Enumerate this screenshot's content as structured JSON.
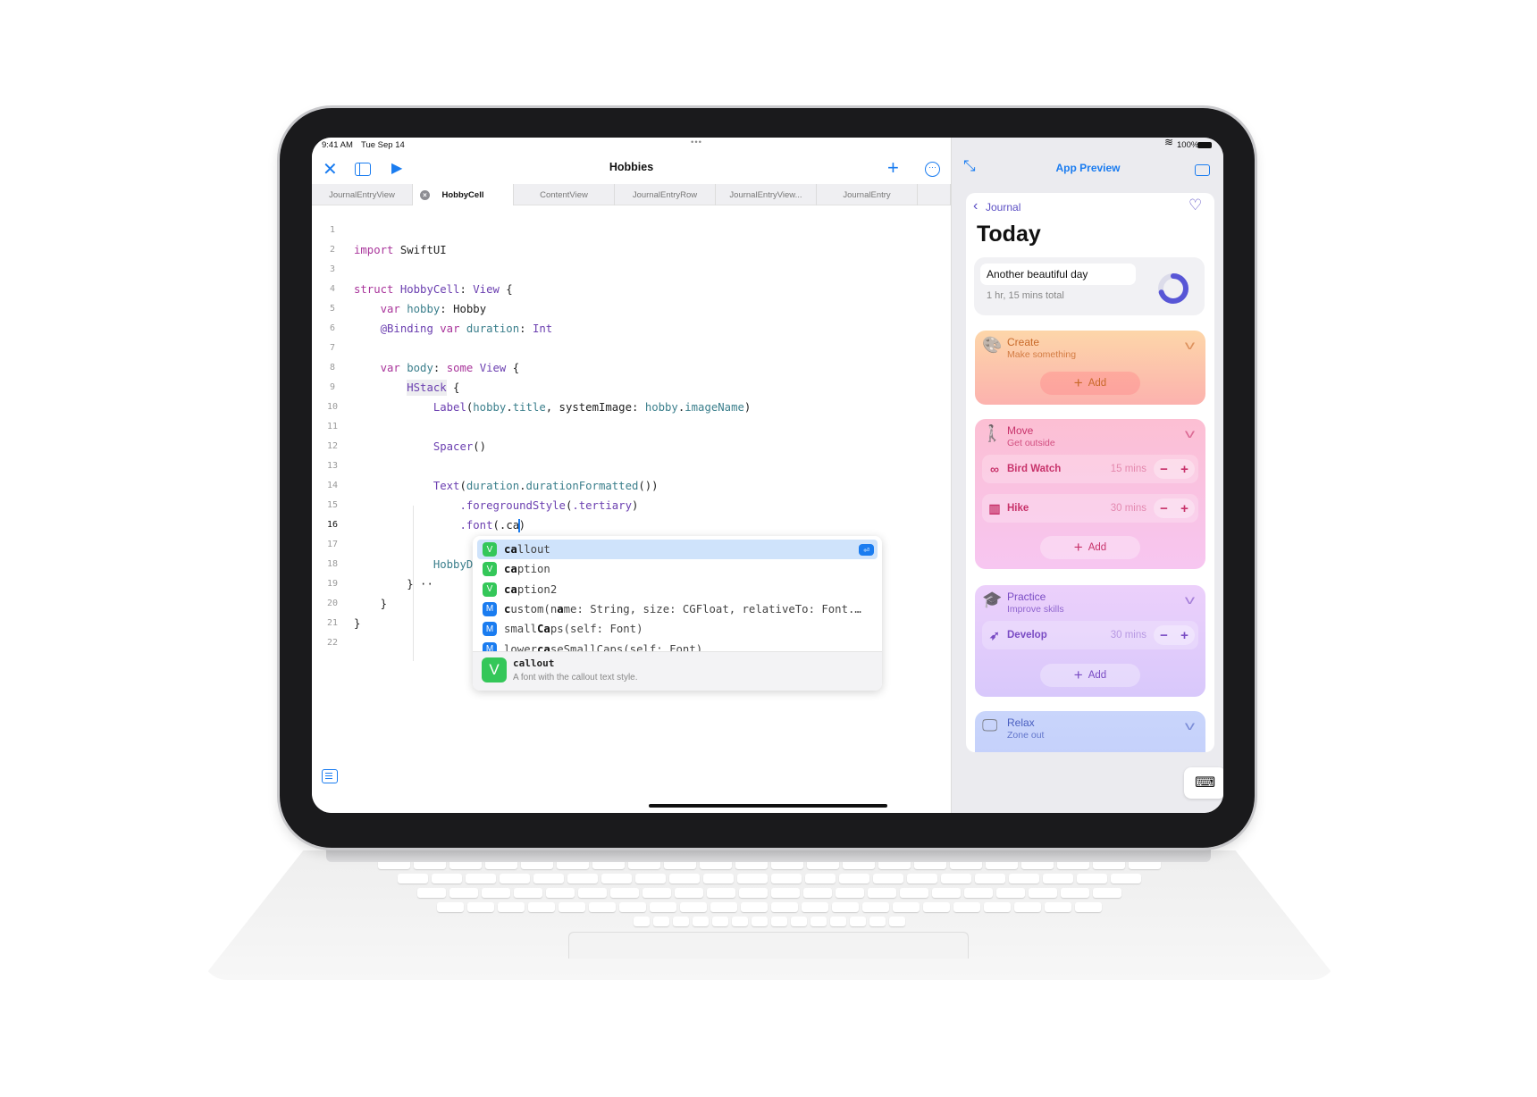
{
  "status": {
    "time": "9:41 AM",
    "date": "Tue Sep 14",
    "battery": "100%",
    "dots": "•••"
  },
  "editor": {
    "title": "Hobbies",
    "tabs": [
      {
        "label": "JournalEntryView"
      },
      {
        "label": "HobbyCell",
        "active": true
      },
      {
        "label": "ContentView"
      },
      {
        "label": "JournalEntryRow"
      },
      {
        "label": "JournalEntryView..."
      },
      {
        "label": "JournalEntry"
      },
      {
        "label": ""
      }
    ],
    "current_line": 16,
    "lines": [
      [],
      [
        [
          "import",
          "k"
        ],
        [
          " SwiftUI",
          "pl"
        ]
      ],
      [],
      [
        [
          "struct",
          "k"
        ],
        [
          " HobbyCell",
          "ty"
        ],
        [
          ": ",
          "pl"
        ],
        [
          "View",
          "ty"
        ],
        [
          " {",
          "pl"
        ]
      ],
      [
        [
          "    "
        ],
        [
          "var",
          "k"
        ],
        [
          " hobby",
          "p"
        ],
        [
          ": ",
          "pl"
        ],
        [
          "Hobby",
          "pl"
        ]
      ],
      [
        [
          "    "
        ],
        [
          "@Binding",
          "ty"
        ],
        [
          " var",
          "k"
        ],
        [
          " duration",
          "p"
        ],
        [
          ": ",
          "pl"
        ],
        [
          "Int",
          "ty"
        ]
      ],
      [],
      [
        [
          "    "
        ],
        [
          "var",
          "k"
        ],
        [
          " body",
          "p"
        ],
        [
          ": ",
          "pl"
        ],
        [
          "some",
          "k"
        ],
        [
          " View",
          "ty"
        ],
        [
          " {",
          "pl"
        ]
      ],
      [
        [
          "        "
        ],
        [
          "HStack",
          "ty"
        ],
        [
          " {",
          "pl"
        ]
      ],
      [
        [
          "            "
        ],
        [
          "Label",
          "ty"
        ],
        [
          "(",
          "pl"
        ],
        [
          "hobby",
          "p"
        ],
        [
          ".",
          "pl"
        ],
        [
          "title",
          "p"
        ],
        [
          ", systemImage: ",
          "pl"
        ],
        [
          "hobby",
          "p"
        ],
        [
          ".",
          "pl"
        ],
        [
          "imageName",
          "p"
        ],
        [
          ")",
          "pl"
        ]
      ],
      [],
      [
        [
          "            "
        ],
        [
          "Spacer",
          "ty"
        ],
        [
          "()",
          "pl"
        ]
      ],
      [],
      [
        [
          "            "
        ],
        [
          "Text",
          "ty"
        ],
        [
          "(",
          "pl"
        ],
        [
          "duration",
          "p"
        ],
        [
          ".",
          "pl"
        ],
        [
          "durationFormatted",
          "p"
        ],
        [
          "())",
          "pl"
        ]
      ],
      [
        [
          "                "
        ],
        [
          ".foregroundStyle",
          "ty"
        ],
        [
          "(",
          "pl"
        ],
        [
          ".tertiary",
          "ty"
        ],
        [
          ")",
          "pl"
        ]
      ],
      [
        [
          "                "
        ],
        [
          ".font",
          "ty"
        ],
        [
          "(.",
          "pl"
        ],
        [
          "ca",
          "pl"
        ],
        [
          ")",
          "pl"
        ]
      ],
      [],
      [
        [
          "            "
        ],
        [
          "HobbyDu",
          "p"
        ]
      ],
      [
        [
          "        "
        ],
        [
          "} ··",
          "pl"
        ]
      ],
      [
        [
          "    "
        ],
        [
          "}",
          "pl"
        ]
      ],
      [
        [
          "}",
          "pl"
        ]
      ],
      []
    ],
    "autocomplete": {
      "items": [
        {
          "kind": "V",
          "segments": [
            [
              "ca",
              true
            ],
            [
              "llout",
              false
            ]
          ],
          "selected": true
        },
        {
          "kind": "V",
          "segments": [
            [
              "ca",
              true
            ],
            [
              "ption",
              false
            ]
          ]
        },
        {
          "kind": "V",
          "segments": [
            [
              "ca",
              true
            ],
            [
              "ption2",
              false
            ]
          ]
        },
        {
          "kind": "M",
          "segments": [
            [
              "c",
              true
            ],
            [
              "ustom(n",
              false
            ],
            [
              "a",
              true
            ],
            [
              "me: String, size: CGFloat, relativeTo: Font.…",
              false
            ]
          ]
        },
        {
          "kind": "M",
          "segments": [
            [
              "small",
              false
            ],
            [
              "Ca",
              true
            ],
            [
              "ps(self: Font)",
              false
            ]
          ]
        },
        {
          "kind": "M",
          "segments": [
            [
              "lower",
              false
            ],
            [
              "ca",
              true
            ],
            [
              "seSmallCaps(self: Font)",
              false
            ]
          ]
        }
      ],
      "detail": {
        "kind": "V",
        "name": "callout",
        "description": "A font with the callout text style."
      }
    }
  },
  "preview": {
    "title": "App Preview",
    "back_label": "Journal",
    "heading": "Today",
    "summary": {
      "entry": "Another beautiful day",
      "total": "1 hr, 15 mins total",
      "progress": 0.7
    },
    "sections": [
      {
        "title": "Create",
        "subtitle": "Make something",
        "icon": "palette-icon",
        "color": "#c9692a",
        "items": [],
        "add": "Add"
      },
      {
        "title": "Move",
        "subtitle": "Get outside",
        "icon": "figure-walk-icon",
        "color": "#c8336b",
        "items": [
          {
            "name": "Bird Watch",
            "icon": "binoculars-icon",
            "duration": "15 mins"
          },
          {
            "name": "Hike",
            "icon": "map-icon",
            "duration": "30 mins"
          }
        ],
        "add": "Add"
      },
      {
        "title": "Practice",
        "subtitle": "Improve skills",
        "icon": "graduation-cap-icon",
        "color": "#7a4cc4",
        "items": [
          {
            "name": "Develop",
            "icon": "swift-icon",
            "duration": "30 mins"
          }
        ],
        "add": "Add"
      },
      {
        "title": "Relax",
        "subtitle": "Zone out",
        "icon": "tv-icon",
        "color": "#4a5fc0",
        "items": []
      }
    ]
  },
  "colors": {
    "accent": "#1a7cf0",
    "ring": "#5856d6",
    "keyword": "#a9359b",
    "type": "#6b3fb0",
    "property": "#3b7f8c"
  }
}
